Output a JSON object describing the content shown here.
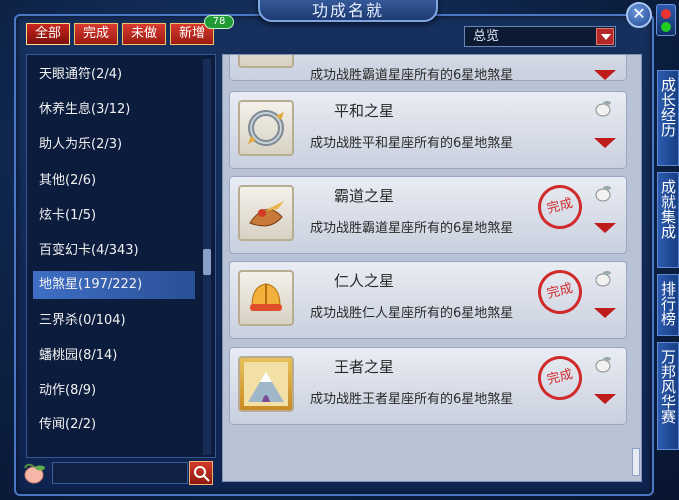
{
  "window": {
    "title": "功成名就",
    "close_glyph": "✕"
  },
  "tabs": [
    {
      "label": "全部"
    },
    {
      "label": "完成"
    },
    {
      "label": "未做"
    },
    {
      "label": "新增"
    }
  ],
  "new_count_badge": "78",
  "filter_select": {
    "value": "总览"
  },
  "categories": [
    {
      "label": "天眼通符(2/4)"
    },
    {
      "label": "休养生息(3/12)"
    },
    {
      "label": "助人为乐(2/3)"
    },
    {
      "label": "其他(2/6)"
    },
    {
      "label": "炫卡(1/5)"
    },
    {
      "label": "百变幻卡(4/343)"
    },
    {
      "label": "地煞星(197/222)"
    },
    {
      "label": "三界杀(0/104)"
    },
    {
      "label": "蟠桃园(8/14)"
    },
    {
      "label": "动作(8/9)"
    },
    {
      "label": "传闻(2/2)"
    }
  ],
  "achievements": [
    {
      "title": "平和之星",
      "desc": "成功战胜平和星座所有的6星地煞星",
      "completed": false,
      "icon": "ring-icon"
    },
    {
      "title": "霸道之星",
      "desc": "成功战胜霸道星座所有的6星地煞星",
      "completed": true,
      "seal": "完成",
      "icon": "flame-shell-icon"
    },
    {
      "title": "仁人之星",
      "desc": "成功战胜仁人星座所有的6星地煞星",
      "completed": true,
      "seal": "完成",
      "icon": "helmet-icon"
    },
    {
      "title": "王者之星",
      "desc": "成功战胜王者星座所有的6星地煞星",
      "completed": true,
      "seal": "完成",
      "icon": "mountain-portrait-icon"
    }
  ],
  "partial_desc_top": "成功战胜霸道星座所有的6星地煞星",
  "side_tabs": [
    {
      "label": "成长经历"
    },
    {
      "label": "成就集成"
    },
    {
      "label": "排行榜"
    },
    {
      "label": "万邦风华赛"
    }
  ],
  "colors": {
    "tab_red": "#c8261c",
    "seal_red": "#d12a2a",
    "panel_blue": "#0b1c3d",
    "highlight": "#3f6fc4"
  }
}
